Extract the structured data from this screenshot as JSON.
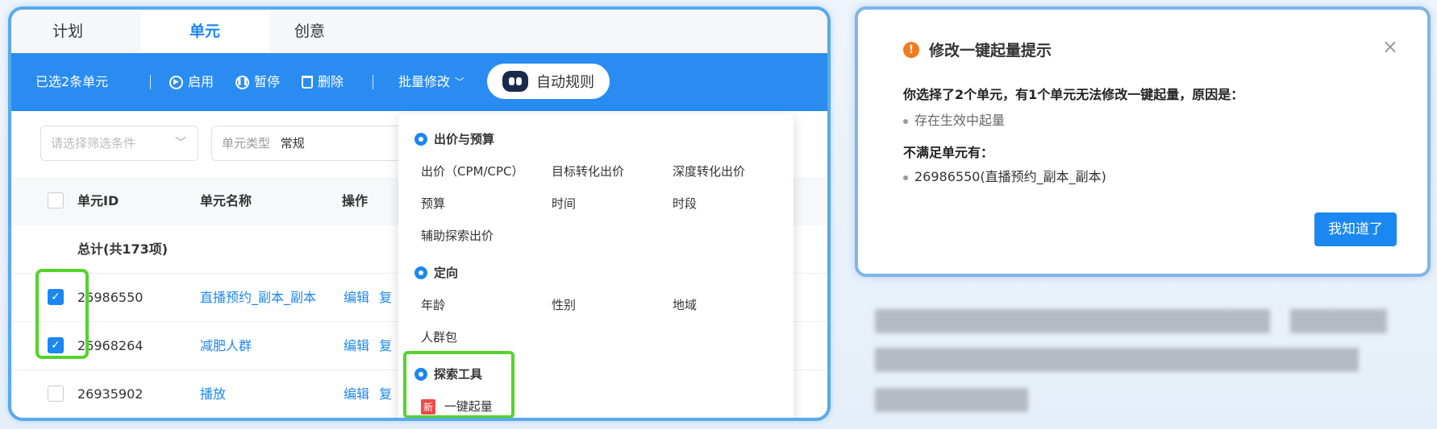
{
  "tabs": [
    "计划",
    "单元",
    "创意"
  ],
  "toolbar": {
    "selected": "已选2条单元",
    "enable": "启用",
    "pause": "暂停",
    "delete": "删除",
    "batch_edit": "批量修改",
    "auto_rule": "自动规则"
  },
  "filter": {
    "placeholder": "请选择筛选条件",
    "type_label": "单元类型",
    "type_value": "常规"
  },
  "table": {
    "headers": [
      "单元ID",
      "单元名称",
      "操作"
    ],
    "total": "总计(共173项)",
    "rows": [
      {
        "id": "26986550",
        "name": "直播预约_副本_副本",
        "op": "编辑",
        "op2": "复",
        "checked": true
      },
      {
        "id": "26968264",
        "name": "减肥人群",
        "op": "编辑",
        "op2": "复",
        "checked": true
      },
      {
        "id": "26935902",
        "name": "播放",
        "op": "编辑",
        "op2": "复",
        "checked": false
      }
    ]
  },
  "dropdown": {
    "sec1": "出价与预算",
    "bid": "出价（CPM/CPC）",
    "target_bid": "目标转化出价",
    "deep_bid": "深度转化出价",
    "budget": "预算",
    "time": "时间",
    "period": "时段",
    "assist": "辅助探索出价",
    "sec2": "定向",
    "age": "年龄",
    "gender": "性别",
    "region": "地域",
    "crowd": "人群包",
    "sec3": "探索工具",
    "new_badge": "新",
    "one_click": "一键起量"
  },
  "modal": {
    "title": "修改一键起量提示",
    "close": "×",
    "line1": "你选择了2个单元，有1个单元无法修改一键起量，原因是：",
    "reason": "存在生效中起量",
    "line2": "不满足单元有：",
    "unit": "26986550(直播预约_副本_副本)",
    "ok": "我知道了"
  }
}
